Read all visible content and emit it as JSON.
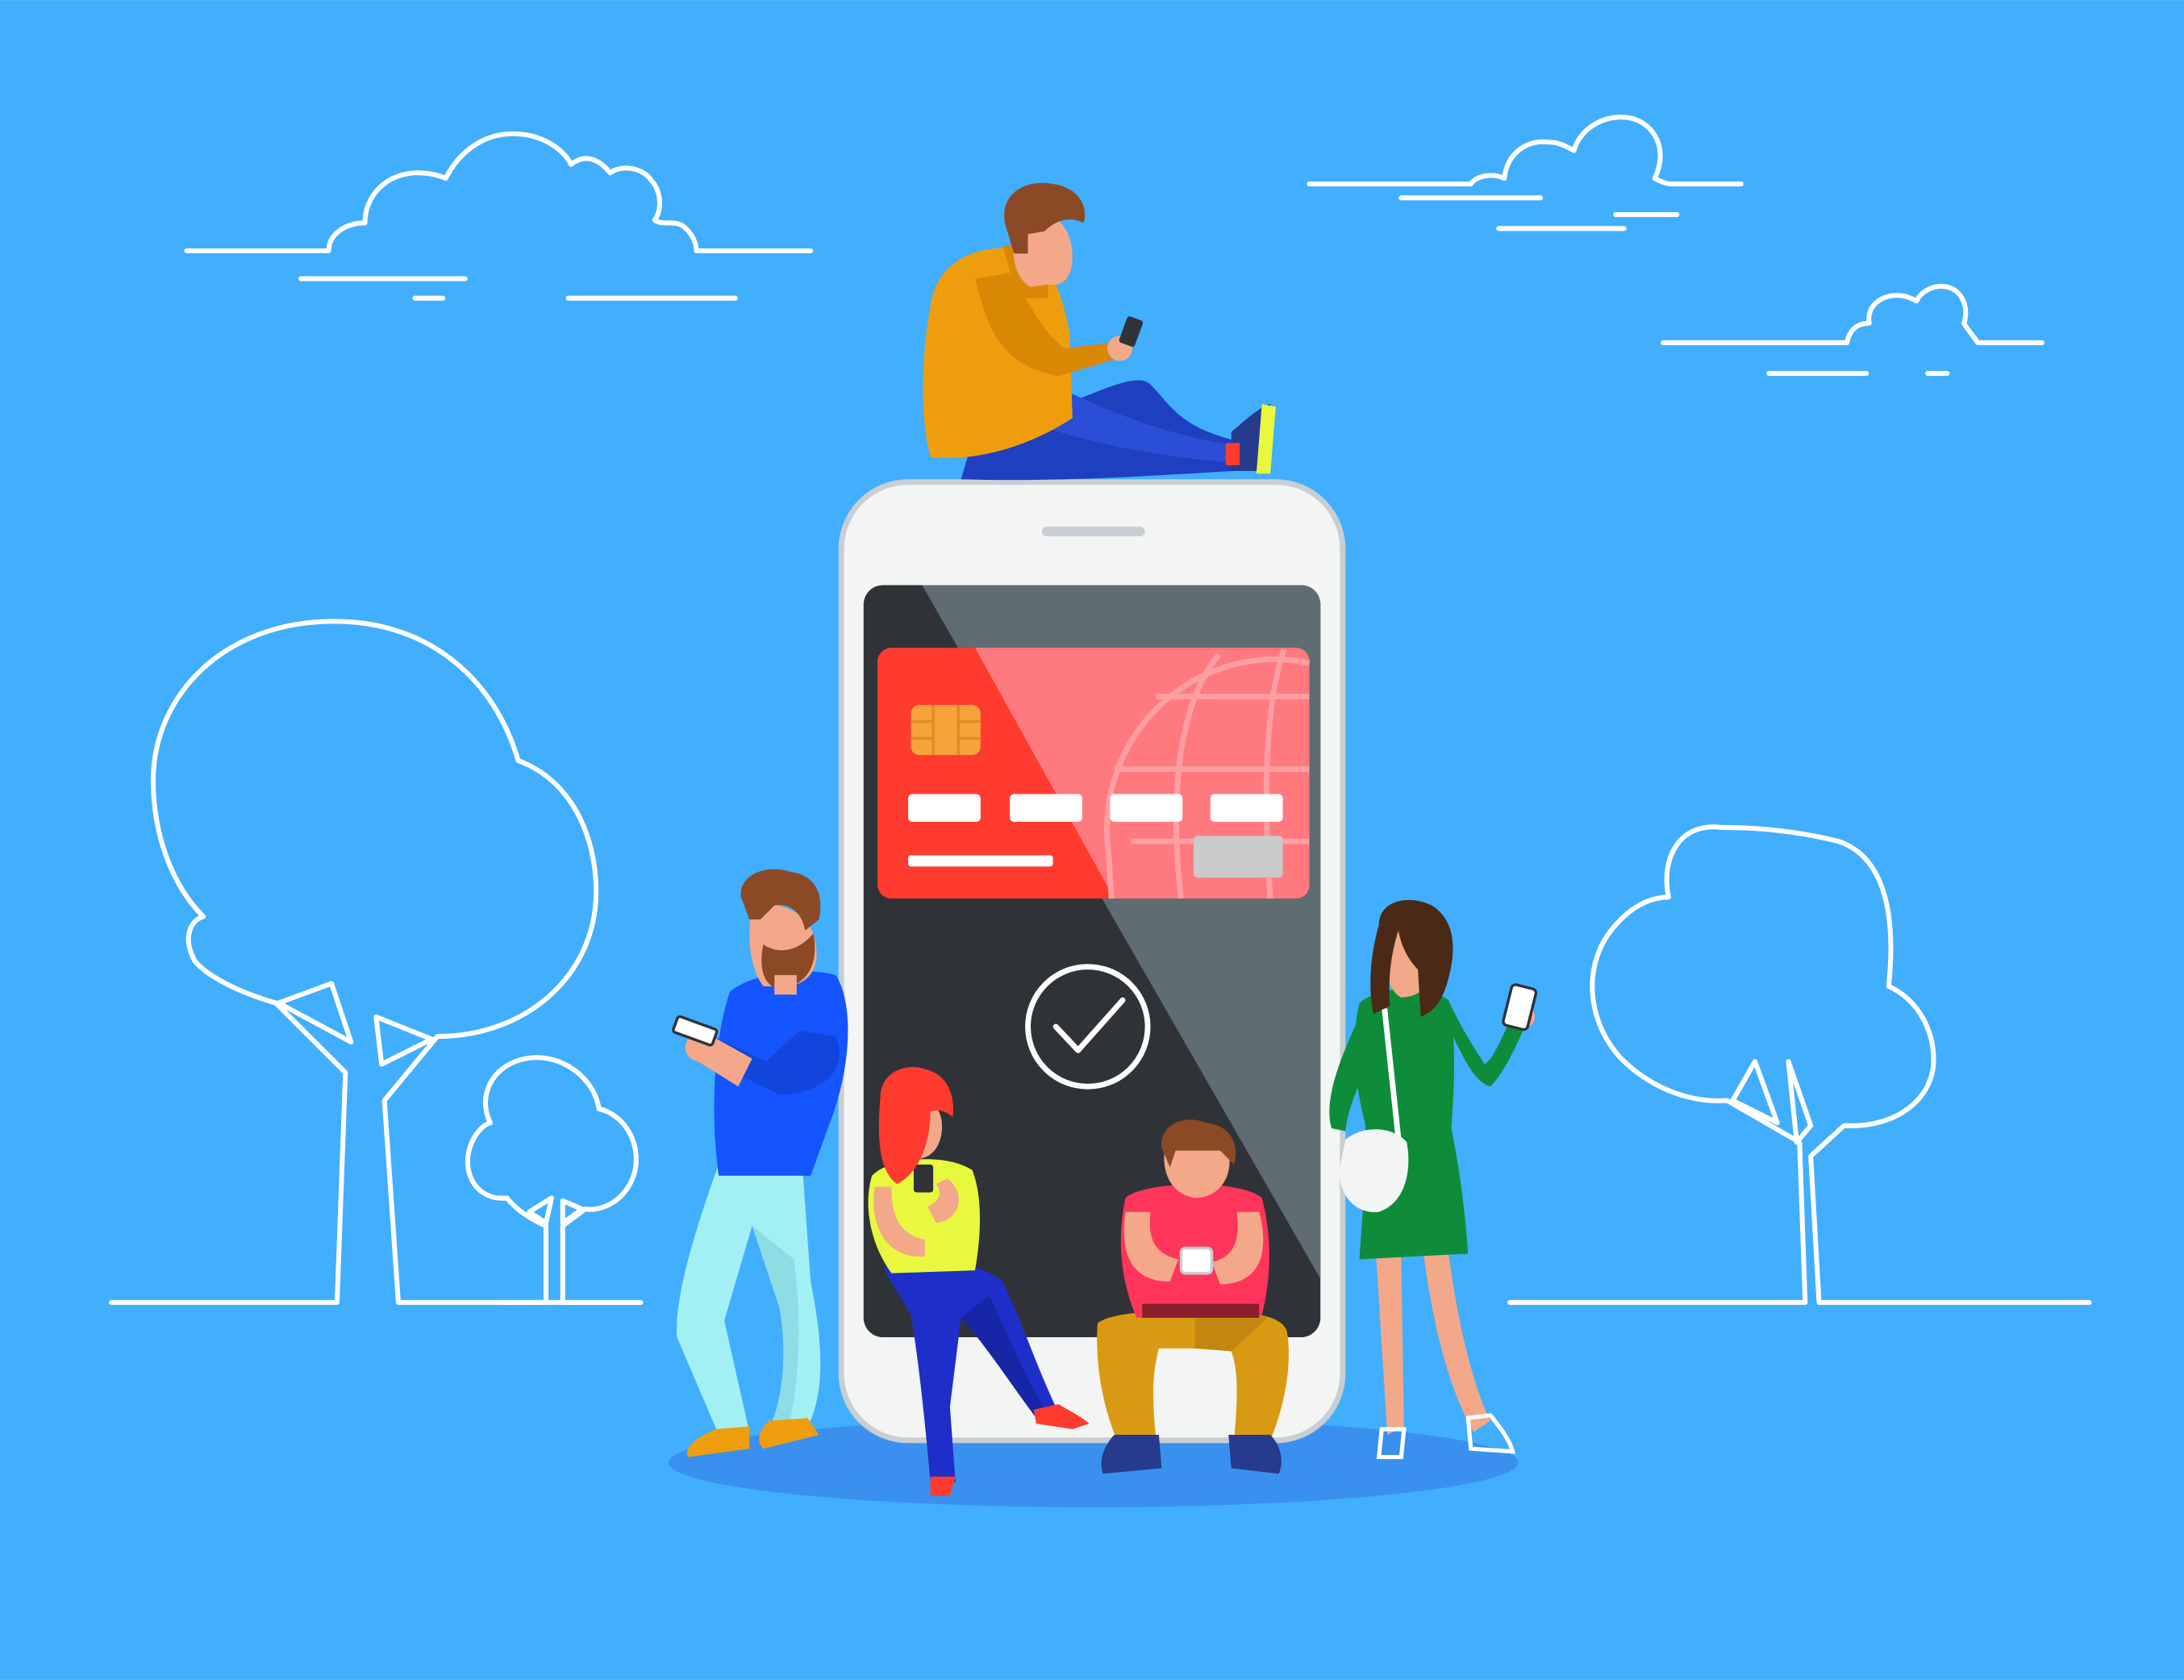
{
  "scene": {
    "background_color": "#42AEFE",
    "outline_color": "#FFFFFF",
    "ground_shadow_color": "#3A90EE"
  },
  "phone": {
    "body_color": "#F3F4F4",
    "border_color": "#C9CED3",
    "screen_color": "#2F3338",
    "screen_glare_color": "#5F6D73",
    "speaker_color": "#C9CED3"
  },
  "card": {
    "color": "#FF3B2F",
    "chip_color": "#F7A33B",
    "number_bar_color": "#FFFFFF",
    "signature_box_color": "#C9CACC",
    "globe_icon": "globe-icon"
  },
  "confirmation": {
    "icon": "checkmark-circle-icon",
    "color": "#FFFFFF"
  },
  "people": [
    {
      "id": "sitting-top",
      "top_color": "#EE9E0C",
      "bottom_color": "#1E3FBF",
      "hair_color": "#8B4A25"
    },
    {
      "id": "bearded-man",
      "top_color": "#1455FF",
      "bottom_color": "#A3F0F4",
      "hair_color": "#8B4A25"
    },
    {
      "id": "red-hair-woman",
      "top_color": "#E8F83E",
      "bottom_color": "#1E2EC8",
      "hair_color": "#FF3B2F"
    },
    {
      "id": "crouching-man",
      "top_color": "#FF355B",
      "bottom_color": "#D89A12",
      "hair_color": "#8B4A25"
    },
    {
      "id": "woman-green-dress",
      "top_color": "#0F8C3A",
      "bottom_color": "#0F8C3A",
      "hair_color": "#4A2A17"
    }
  ],
  "skin_color": "#F2A889"
}
